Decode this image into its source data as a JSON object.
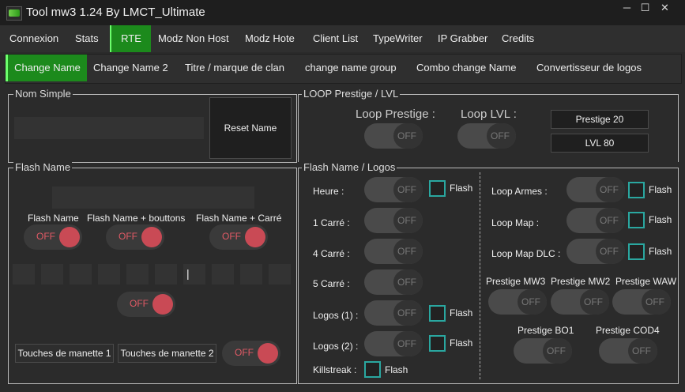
{
  "window": {
    "title": "Tool mw3 1.24 By LMCT_Ultimate",
    "minimize": "─",
    "maximize": "☐",
    "close": "✕"
  },
  "tabs_main": [
    "Connexion",
    "Stats",
    "RTE",
    "Modz Non Host",
    "Modz Hote",
    "Client List",
    "TypeWriter",
    "IP Grabber",
    "Credits"
  ],
  "tabs_sub": [
    "Change Name",
    "Change Name 2",
    "Titre / marque de clan",
    "change name group",
    "Combo change Name",
    "Convertisseur de logos"
  ],
  "nom_simple": {
    "title": "Nom Simple",
    "reset_button": "Reset Name"
  },
  "loop": {
    "title": "LOOP Prestige / LVL",
    "loop_prestige": "Loop Prestige :",
    "loop_lvl": "Loop LVL :",
    "prestige_button": "Prestige 20",
    "lvl_button": "LVL 80",
    "off": "OFF"
  },
  "flash_name": {
    "title": "Flash Name",
    "opt1": "Flash Name",
    "opt2": "Flash Name + bouttons",
    "opt3": "Flash Name + Carré",
    "off": "OFF",
    "cursor": "|",
    "btn1": "Touches de manette 1",
    "btn2": "Touches de manette 2"
  },
  "flash_logos": {
    "title": "Flash Name / Logos",
    "off": "OFF",
    "flash": "Flash",
    "left": [
      "Heure :",
      "1 Carré :",
      "4 Carré :",
      "5 Carré :",
      "Logos (1) :",
      "Logos (2) :",
      "Killstreak :"
    ],
    "right": [
      "Loop Armes :",
      "Loop Map :",
      "Loop Map DLC :"
    ],
    "prestige": [
      "Prestige MW3",
      "Prestige MW2",
      "Prestige WAW",
      "Prestige BO1",
      "Prestige COD4"
    ]
  },
  "colors": {
    "accent_green": "#1c8a1c",
    "toggle_on": "#c94a55",
    "checkbox": "#2aa7a0"
  }
}
